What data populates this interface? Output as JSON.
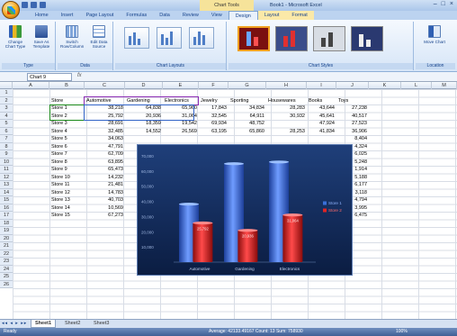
{
  "title_bar": {
    "context_title": "Chart Tools",
    "app_title": "Book1 - Microsoft Excel",
    "window_controls": [
      "–",
      "□",
      "×"
    ]
  },
  "tabs": [
    {
      "label": "Home"
    },
    {
      "label": "Insert"
    },
    {
      "label": "Page Layout"
    },
    {
      "label": "Formulas"
    },
    {
      "label": "Data"
    },
    {
      "label": "Review"
    },
    {
      "label": "View"
    },
    {
      "label": "Design"
    },
    {
      "label": "Layout"
    },
    {
      "label": "Format"
    }
  ],
  "ribbon": {
    "type_group": {
      "label": "Type",
      "buttons": [
        "Change Chart Type",
        "Save As Template"
      ]
    },
    "data_group": {
      "label": "Data",
      "buttons": [
        "Switch Row/Column",
        "Edit Data Source"
      ]
    },
    "layouts_group": {
      "label": "Chart Layouts"
    },
    "styles_group": {
      "label": "Chart Styles"
    },
    "location_group": {
      "label": "Location",
      "buttons": [
        "Move Chart"
      ]
    }
  },
  "name_box": "Chart 9",
  "fx_label": "fx",
  "columns": [
    "A",
    "B",
    "C",
    "D",
    "E",
    "F",
    "G",
    "H",
    "I",
    "J",
    "K",
    "L",
    "M"
  ],
  "rows": [
    "1",
    "2",
    "3",
    "4",
    "5",
    "6",
    "7",
    "8",
    "9",
    "10",
    "11",
    "12",
    "13",
    "14",
    "15",
    "16",
    "17",
    "18",
    "19",
    "20",
    "21",
    "22",
    "23",
    "24",
    "25",
    "26"
  ],
  "table": {
    "headers": [
      "Store",
      "Automotive",
      "Gardening",
      "Electronics",
      "Jewelry",
      "Sporting",
      "Housewares",
      "Books",
      "Toys"
    ],
    "rows": [
      [
        "Store 1",
        "38,218",
        "64,838",
        "65,960",
        "17,843",
        "34,834",
        "28,283",
        "43,644",
        "27,238"
      ],
      [
        "Store 2",
        "25,792",
        "20,936",
        "31,064",
        "32,545",
        "64,911",
        "30,932",
        "45,641",
        "40,517"
      ],
      [
        "Store 3",
        "28,691",
        "18,359",
        "19,542",
        "69,934",
        "48,752",
        "",
        "47,924",
        "27,523"
      ],
      [
        "Store 4",
        "32,485",
        "14,552",
        "26,569",
        "63,195",
        "65,860",
        "28,253",
        "41,834",
        "36,906"
      ],
      [
        "Store 5",
        "34,063",
        "",
        "",
        "",
        "",
        "",
        "",
        "8,404"
      ],
      [
        "Store 6",
        "47,791",
        "",
        "",
        "",
        "",
        "",
        "",
        "4,324"
      ],
      [
        "Store 7",
        "62,709",
        "",
        "",
        "",
        "",
        "",
        "",
        "6,025"
      ],
      [
        "Store 8",
        "63,895",
        "",
        "",
        "",
        "",
        "",
        "",
        "5,248"
      ],
      [
        "Store 9",
        "65,473",
        "",
        "",
        "",
        "",
        "",
        "",
        "1,914"
      ],
      [
        "Store 10",
        "14,232",
        "",
        "",
        "",
        "",
        "",
        "",
        "5,188"
      ],
      [
        "Store 11",
        "21,481",
        "",
        "",
        "",
        "",
        "",
        "",
        "6,177"
      ],
      [
        "Store 12",
        "14,783",
        "",
        "",
        "",
        "",
        "",
        "",
        "3,118"
      ],
      [
        "Store 13",
        "40,703",
        "",
        "",
        "",
        "",
        "",
        "",
        "4,794"
      ],
      [
        "Store 14",
        "10,569",
        "",
        "",
        "",
        "",
        "",
        "",
        "3,995"
      ],
      [
        "Store 15",
        "67,273",
        "",
        "",
        "",
        "",
        "",
        "",
        "6,475"
      ]
    ]
  },
  "chart_data": {
    "type": "bar",
    "categories": [
      "Automotive",
      "Gardening",
      "Electronics"
    ],
    "series": [
      {
        "name": "Store 1",
        "values": [
          38218,
          64838,
          65960
        ],
        "color": "#3a6fd8"
      },
      {
        "name": "Store 2",
        "values": [
          25792,
          20936,
          31064
        ],
        "color": "#e02424"
      }
    ],
    "data_labels": [
      "",
      "",
      "",
      "25,792",
      "20,936",
      "31,064"
    ],
    "y_ticks": [
      "10,000",
      "20,000",
      "30,000",
      "40,000",
      "50,000",
      "60,000",
      "70,000"
    ],
    "ylim": [
      0,
      70000
    ],
    "legend_position": "right",
    "grid": false
  },
  "sheet_tabs": [
    "Sheet1",
    "Sheet2",
    "Sheet3"
  ],
  "sheet_nav": "◂◂ ◂ ▸ ▸▸",
  "status": {
    "ready": "Ready",
    "summary": "Average: 42133.49167    Count: 13    Sum: 758930",
    "zoom": "100%"
  }
}
